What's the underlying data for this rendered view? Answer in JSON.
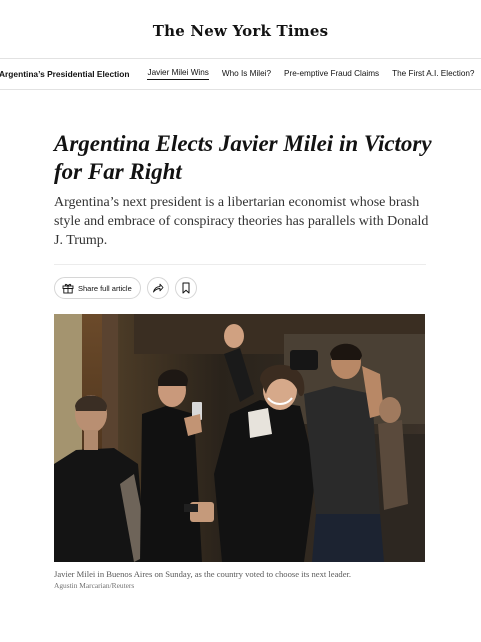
{
  "masthead": {
    "logo_text": "The New York Times"
  },
  "subnav": {
    "section_label": "Argentina’s Presidential Election",
    "links": [
      {
        "label": "Javier Milei Wins",
        "active": true
      },
      {
        "label": "Who Is Milei?"
      },
      {
        "label": "Pre-emptive Fraud Claims"
      },
      {
        "label": "The First A.I. Election?"
      }
    ]
  },
  "article": {
    "headline": "Argentina Elects Javier Milei in Victory for Far Right",
    "summary": "Argentina’s next president is a libertarian economist whose brash style and embrace of conspiracy theories has parallels with Donald J. Trump.",
    "share_label": "Share full article",
    "image": {
      "caption": "Javier Milei in Buenos Aires on Sunday, as the country voted to choose its next leader.",
      "credit": "Agustin Marcarian/Reuters"
    }
  },
  "icons": {
    "gift": "gift-icon",
    "share": "share-arrow-icon",
    "bookmark": "bookmark-icon"
  },
  "colors": {
    "text": "#121212",
    "rule": "#e2e2e2",
    "caption": "#5a5a5a"
  }
}
